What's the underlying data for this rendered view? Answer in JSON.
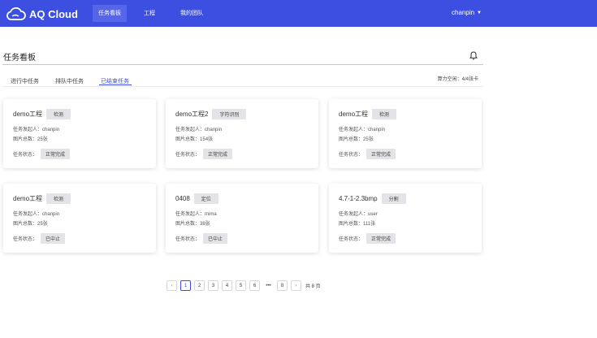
{
  "header": {
    "logo_text": "AQ Cloud",
    "nav": [
      {
        "label": "任务看板",
        "active": true
      },
      {
        "label": "工程",
        "active": false
      },
      {
        "label": "我的团队",
        "active": false
      }
    ],
    "user": "chanpin"
  },
  "page": {
    "title": "任务看板",
    "tabs": [
      {
        "label": "进行中任务",
        "active": false
      },
      {
        "label": "排队中任务",
        "active": false
      },
      {
        "label": "已结束任务",
        "active": true
      }
    ],
    "compute_label": "算力空闲：4/4张卡"
  },
  "cards": [
    {
      "name": "demo工程",
      "tag": "检测",
      "initiator_label": "任务发起人：",
      "initiator": "chanpin",
      "stat_label": "图片总数：",
      "stat": "25张",
      "status_label": "任务状态：",
      "status": "正常完成"
    },
    {
      "name": "demo工程2",
      "tag": "字符识别",
      "initiator_label": "任务发起人：",
      "initiator": "chanpin",
      "stat_label": "图片总数：",
      "stat": "154张",
      "status_label": "任务状态：",
      "status": "正常完成"
    },
    {
      "name": "demo工程",
      "tag": "检测",
      "initiator_label": "任务发起人：",
      "initiator": "chanpin",
      "stat_label": "图片总数：",
      "stat": "25张",
      "status_label": "任务状态：",
      "status": "正常完成"
    },
    {
      "name": "demo工程",
      "tag": "检测",
      "initiator_label": "任务发起人：",
      "initiator": "chanpin",
      "stat_label": "图片总数：",
      "stat": "25张",
      "status_label": "任务状态：",
      "status": "已中止"
    },
    {
      "name": "0408",
      "tag": "定位",
      "initiator_label": "任务发起人：",
      "initiator": "mima",
      "stat_label": "图片总数：",
      "stat": "38张",
      "status_label": "任务状态：",
      "status": "已中止"
    },
    {
      "name": "4.7-1-2.3bmp",
      "tag": "分割",
      "initiator_label": "任务发起人：",
      "initiator": "user",
      "stat_label": "图片总数：",
      "stat": "111张",
      "status_label": "任务状态：",
      "status": "正常完成"
    }
  ],
  "pagination": {
    "prev": "‹",
    "pages": [
      "1",
      "2",
      "3",
      "4",
      "5",
      "6"
    ],
    "ellipsis": "•••",
    "last": "8",
    "next": "›",
    "current": 1,
    "total_label": "共 8 页"
  },
  "icons": {
    "logo": "cloud-icon",
    "bell": "bell-icon",
    "caret": "caret-down-icon"
  },
  "colors": {
    "brand": "#3d4fe0",
    "tag_bg": "#e3e3e8"
  }
}
